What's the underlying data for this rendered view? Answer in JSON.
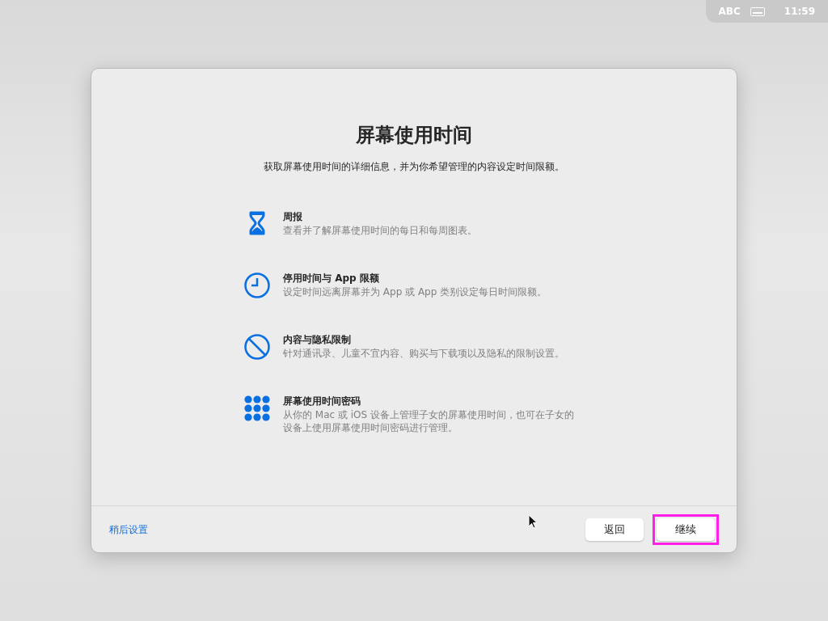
{
  "menu_bar": {
    "input_source": "ABC",
    "time": "11:59"
  },
  "dialog": {
    "title": "屏幕使用时间",
    "subtitle": "获取屏幕使用时间的详细信息，并为你希望管理的内容设定时间限额。",
    "features": [
      {
        "kind": "hourglass",
        "title": "周报",
        "description": "查看并了解屏幕使用时间的每日和每周图表。"
      },
      {
        "kind": "clock",
        "title": "停用时间与 App 限额",
        "description": "设定时间远离屏幕并为 App 或 App 类别设定每日时间限额。"
      },
      {
        "kind": "prohibited",
        "title": "内容与隐私限制",
        "description": "针对通讯录、儿童不宜内容、购买与下载项以及隐私的限制设置。"
      },
      {
        "kind": "keypad",
        "title": "屏幕使用时间密码",
        "description": "从你的 Mac 或 iOS 设备上管理子女的屏幕使用时间，也可在子女的设备上使用屏幕使用时间密码进行管理。"
      }
    ],
    "footer": {
      "link": "稍后设置",
      "buttons": [
        {
          "label": "返回",
          "highlighted": false
        },
        {
          "label": "继续",
          "highlighted": true
        }
      ]
    }
  }
}
